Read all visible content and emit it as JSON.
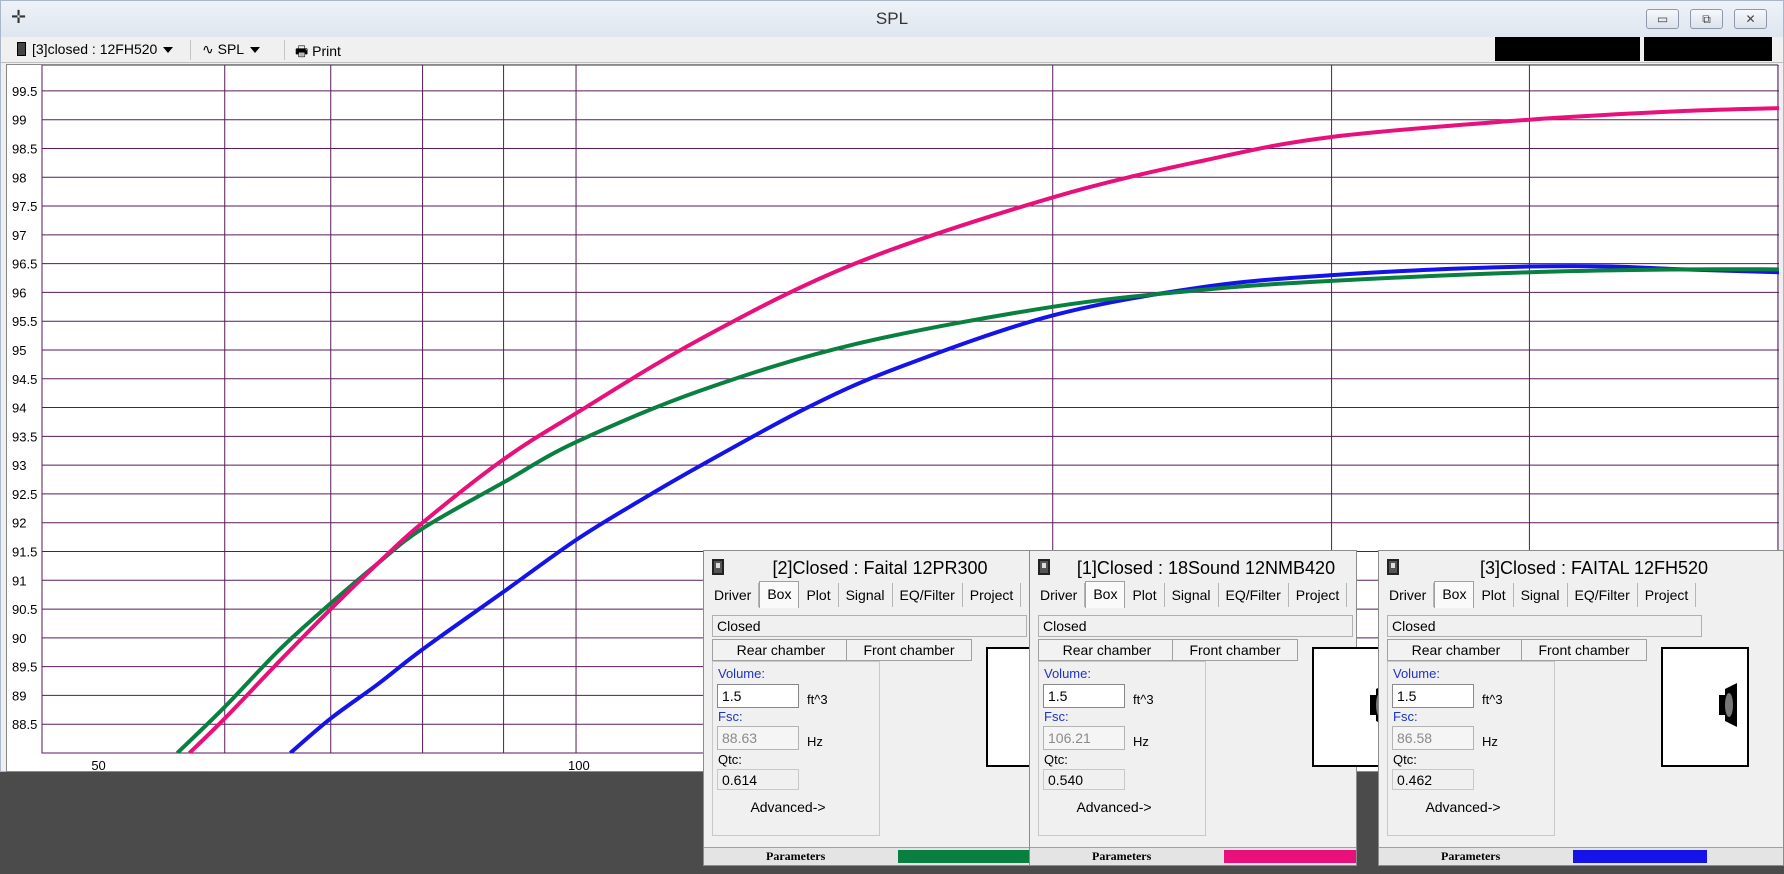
{
  "window": {
    "title": "SPL",
    "app_icon": "crosshair-icon",
    "controls": [
      "minimize",
      "restore",
      "close"
    ]
  },
  "toolbar": {
    "driver_select": "[3]closed : 12FH520",
    "plot_select": "SPL",
    "print_label": "Print"
  },
  "colors": {
    "grid": "#5a1a5a",
    "series_1": "#1414e8",
    "series_2": "#0a8040",
    "series_3": "#e8107a"
  },
  "chart_data": {
    "type": "line",
    "xscale": "log",
    "xlim": [
      46,
      575
    ],
    "ylim": [
      88.0,
      99.95
    ],
    "x_tick_labels": [
      {
        "value": 50,
        "label": "50"
      },
      {
        "value": 100,
        "label": "100"
      }
    ],
    "x_gridlines": [
      60,
      70,
      80,
      90,
      100,
      200,
      300,
      400
    ],
    "y_ticks": [
      "88.5",
      "89",
      "89.5",
      "90",
      "90.5",
      "91",
      "91.5",
      "92",
      "92.5",
      "93",
      "93.5",
      "94",
      "94.5",
      "95",
      "95.5",
      "96",
      "96.5",
      "97",
      "97.5",
      "98",
      "98.5",
      "99",
      "99.5"
    ],
    "series": [
      {
        "name": "[1]Closed : 18Sound 12NMB420",
        "color": "#1414e8",
        "x": [
          66,
          70,
          75,
          80,
          90,
          100,
          110,
          120,
          140,
          160,
          200,
          250,
          300,
          350,
          400,
          450,
          500,
          575
        ],
        "y": [
          88.0,
          88.6,
          89.2,
          89.8,
          90.8,
          91.7,
          92.4,
          93.0,
          94.0,
          94.7,
          95.6,
          96.1,
          96.3,
          96.4,
          96.45,
          96.45,
          96.4,
          96.35
        ]
      },
      {
        "name": "[2]Closed : Faital 12PR300",
        "color": "#0a8040",
        "x": [
          56,
          60,
          65,
          70,
          75,
          80,
          90,
          100,
          120,
          150,
          200,
          250,
          300,
          400,
          500,
          575
        ],
        "y": [
          88.0,
          88.8,
          89.8,
          90.6,
          91.3,
          91.9,
          92.7,
          93.4,
          94.3,
          95.1,
          95.75,
          96.05,
          96.2,
          96.35,
          96.4,
          96.4
        ]
      },
      {
        "name": "[3]Closed : FAITAL 12FH520",
        "color": "#e8107a",
        "x": [
          57,
          60,
          65,
          70,
          75,
          80,
          90,
          100,
          120,
          150,
          200,
          250,
          300,
          400,
          500,
          575
        ],
        "y": [
          88.0,
          88.6,
          89.6,
          90.5,
          91.3,
          92.0,
          93.1,
          93.9,
          95.2,
          96.5,
          97.65,
          98.3,
          98.7,
          99.0,
          99.15,
          99.2
        ]
      }
    ]
  },
  "panels": [
    {
      "title": "[2]Closed : Faital 12PR300",
      "tabs": [
        "Driver",
        "Box",
        "Plot",
        "Signal",
        "EQ/Filter",
        "Project"
      ],
      "enclosure_type": "Closed",
      "rear_chamber": "Rear chamber",
      "front_chamber": "Front chamber",
      "volume_label": "Volume:",
      "volume": "1.5",
      "volume_unit": "ft^3",
      "fsc_label": "Fsc:",
      "fsc": "88.63",
      "fsc_unit": "Hz",
      "qtc_label": "Qtc:",
      "qtc": "0.614",
      "advanced": "Advanced->",
      "status_label": "Parameters",
      "color": "#0a8040",
      "speaker_drawing": false
    },
    {
      "title": "[1]Closed : 18Sound 12NMB420",
      "tabs": [
        "Driver",
        "Box",
        "Plot",
        "Signal",
        "EQ/Filter",
        "Project"
      ],
      "enclosure_type": "Closed",
      "rear_chamber": "Rear chamber",
      "front_chamber": "Front chamber",
      "volume_label": "Volume:",
      "volume": "1.5",
      "volume_unit": "ft^3",
      "fsc_label": "Fsc:",
      "fsc": "106.21",
      "fsc_unit": "Hz",
      "qtc_label": "Qtc:",
      "qtc": "0.540",
      "advanced": "Advanced->",
      "status_label": "Parameters",
      "color": "#e8107a",
      "speaker_drawing": true
    },
    {
      "title": "[3]Closed : FAITAL 12FH520",
      "tabs": [
        "Driver",
        "Box",
        "Plot",
        "Signal",
        "EQ/Filter",
        "Project"
      ],
      "enclosure_type": "Closed",
      "rear_chamber": "Rear chamber",
      "front_chamber": "Front chamber",
      "volume_label": "Volume:",
      "volume": "1.5",
      "volume_unit": "ft^3",
      "fsc_label": "Fsc:",
      "fsc": "86.58",
      "fsc_unit": "Hz",
      "qtc_label": "Qtc:",
      "qtc": "0.462",
      "advanced": "Advanced->",
      "status_label": "Parameters",
      "color": "#1414e8",
      "speaker_drawing": true
    }
  ]
}
